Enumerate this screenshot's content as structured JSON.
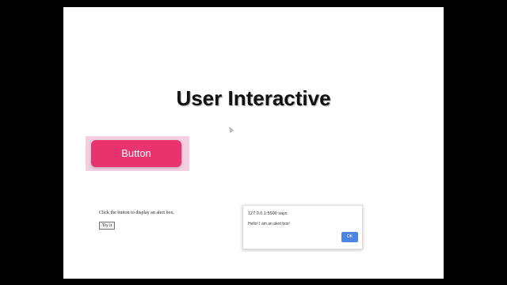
{
  "slide": {
    "title": "User Interactive"
  },
  "demo_button": {
    "label": "Button"
  },
  "alert_demo": {
    "instruction": "Click the button to display an alert box.",
    "try_label": "Try it"
  },
  "alert_dialog": {
    "origin": "127.0.0.1:5500 says",
    "message": "Hello! I am an alert box!",
    "ok_label": "OK"
  },
  "colors": {
    "button": "#e8336f",
    "button_halo": "#f3cfdf",
    "ok_button": "#4a86e8"
  }
}
